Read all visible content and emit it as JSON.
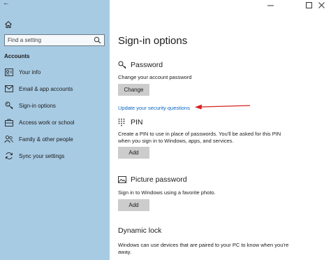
{
  "window": {
    "minimize_glyph": "—",
    "maximize_glyph": "☐",
    "close_glyph": "✕"
  },
  "sidebar": {
    "back_glyph": "←",
    "search": {
      "placeholder": "Find a setting",
      "value": ""
    },
    "section_title": "Accounts",
    "items": [
      {
        "label": "Your info",
        "icon": "person-card-icon"
      },
      {
        "label": "Email & app accounts",
        "icon": "envelope-icon"
      },
      {
        "label": "Sign-in options",
        "icon": "key-icon"
      },
      {
        "label": "Access work or school",
        "icon": "briefcase-icon"
      },
      {
        "label": "Family & other people",
        "icon": "people-icon"
      },
      {
        "label": "Sync your settings",
        "icon": "sync-icon"
      }
    ]
  },
  "main": {
    "title": "Sign-in options",
    "password": {
      "heading": "Password",
      "description": "Change your account password",
      "button": "Change",
      "link": "Update your security questions"
    },
    "pin": {
      "heading": "PIN",
      "description": "Create a PIN to use in place of passwords. You'll be asked for this PIN when you sign in to Windows, apps, and services.",
      "button": "Add"
    },
    "picture_password": {
      "heading": "Picture password",
      "description": "Sign in to Windows using a favorite photo.",
      "button": "Add"
    },
    "dynamic_lock": {
      "heading": "Dynamic lock",
      "description": "Windows can use devices that are paired to your PC to know when you're away."
    }
  },
  "colors": {
    "sidebar_bg": "#a8cbe4",
    "link": "#0a66c2",
    "button_bg": "#cccccc",
    "annotation_arrow": "#d62020"
  }
}
